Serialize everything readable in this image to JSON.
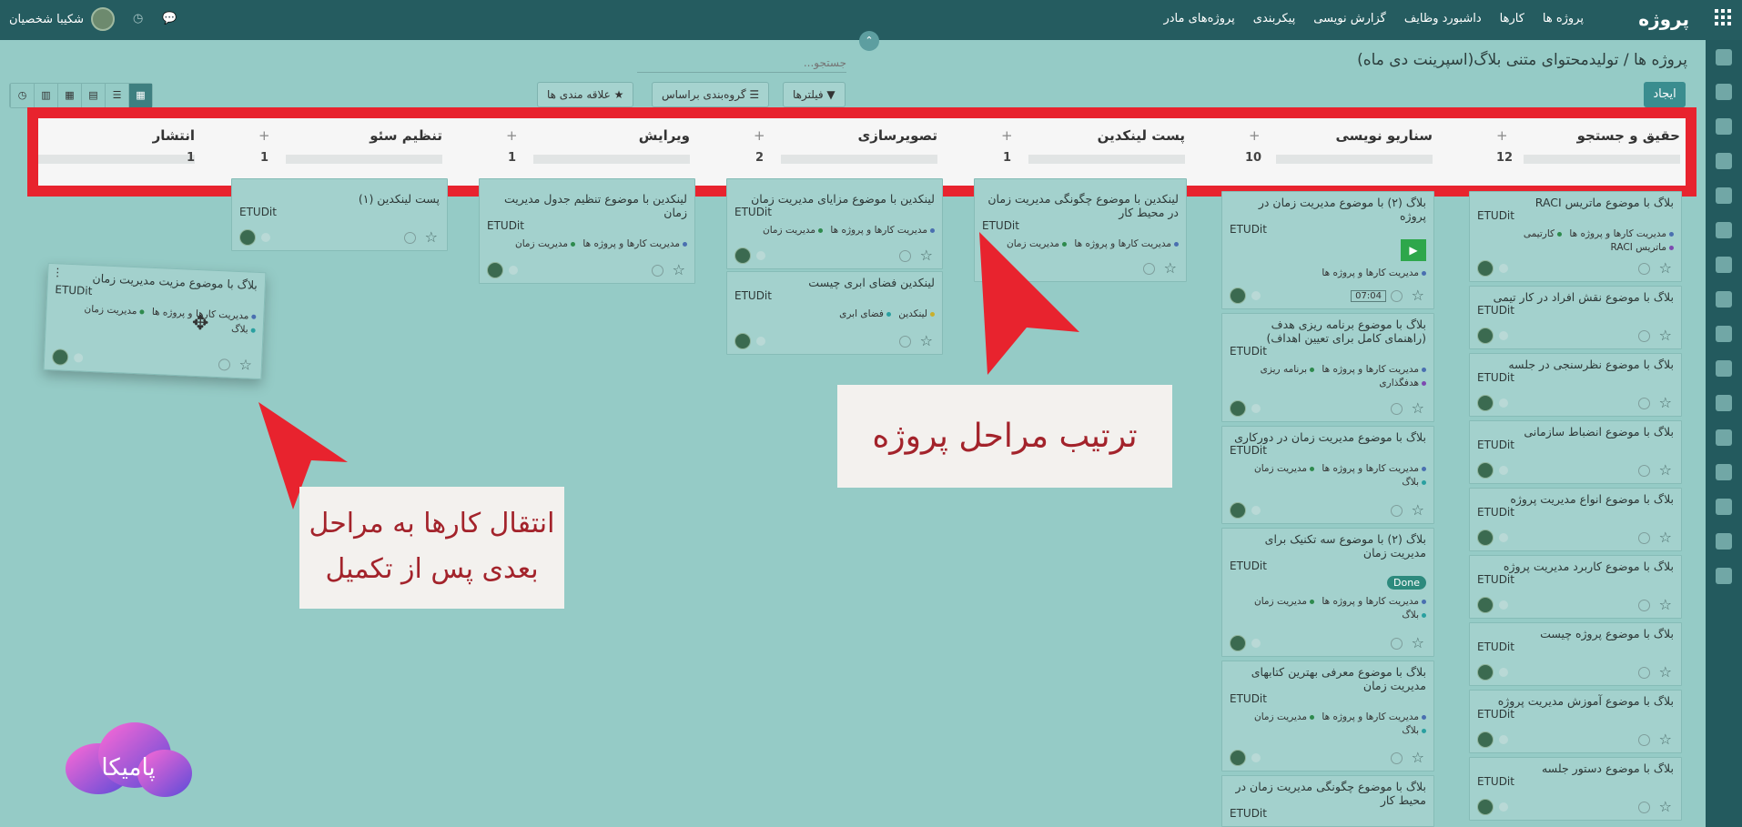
{
  "app": {
    "brand": "پروژه",
    "nav": [
      "پروژه ها",
      "کارها",
      "داشبورد وظایف",
      "گزارش نویسی",
      "پیکربندی",
      "پروژه‌های مادر"
    ],
    "user": "شکیبا شخصیان"
  },
  "breadcrumb": {
    "root": "پروژه ها",
    "sep": "/",
    "current": "تولیدمحتوای متنی بلاگ(اسپرینت دی ماه)"
  },
  "toolbar": {
    "create": "ایجاد",
    "search_placeholder": "جستجو...",
    "filters": "▼ فیلترها",
    "groupby": "☰ گروه‌بندی براساس",
    "favorites": "★ علاقه مندی ها"
  },
  "stages": [
    {
      "title": "حقیق و جستجو",
      "count": "12"
    },
    {
      "title": "سناریو نویسی",
      "count": "10"
    },
    {
      "title": "پست لینکدین",
      "count": "1"
    },
    {
      "title": "تصویرسازی",
      "count": "2"
    },
    {
      "title": "ویرایش",
      "count": "1"
    },
    {
      "title": "تنظیم سئو",
      "count": "1"
    },
    {
      "title": "انتشار",
      "count": "1"
    }
  ],
  "company": "ETUDit",
  "col1": [
    {
      "title": "بلاگ با موضوع ماتریس RACI",
      "tags": [
        "مدیریت کارها و پروژه ها",
        "کارتیمی",
        "ماتریس RACI"
      ]
    },
    {
      "title": "بلاگ با موضوع نقش افراد در کار تیمی"
    },
    {
      "title": "بلاگ با موضوع نظرسنجی در جلسه"
    },
    {
      "title": "بلاگ با موضوع انضباط سازمانی"
    },
    {
      "title": "بلاگ با موضوع انواع مدیریت پروژه"
    },
    {
      "title": "بلاگ با موضوع کاربرد مدیریت پروژه"
    },
    {
      "title": "بلاگ با موضوع پروژه چیست"
    },
    {
      "title": "بلاگ با موضوع آموزش مدیریت پروژه"
    },
    {
      "title": "بلاگ با موضوع دستور جلسه"
    }
  ],
  "col2": [
    {
      "title": "بلاگ (۲) با موضوع مدیریت زمان در پروژه",
      "tags": [
        "مدیریت کارها و پروژه ها"
      ],
      "timer": "07:04"
    },
    {
      "title": "بلاگ با موضوع برنامه ریزی هدف (راهنمای کامل برای تعیین اهداف)",
      "tags": [
        "مدیریت کارها و پروژه ها",
        "برنامه ریزی",
        "هدفگذاری"
      ]
    },
    {
      "title": "بلاگ با موضوع مدیریت زمان در دورکاری",
      "tags": [
        "مدیریت کارها و پروژه ها",
        "مدیریت زمان",
        "بلاگ"
      ]
    },
    {
      "title": "بلاگ (۲) با موضوع سه تکنیک برای مدیریت زمان",
      "badge": "Done",
      "tags": [
        "مدیریت کارها و پروژه ها",
        "مدیریت زمان",
        "بلاگ"
      ]
    },
    {
      "title": "بلاگ با موضوع معرفی بهترین کتابهای مدیریت زمان",
      "tags": [
        "مدیریت کارها و پروژه ها",
        "مدیریت زمان",
        "بلاگ"
      ]
    },
    {
      "title": "بلاگ با موضوع چگونگی مدیریت زمان در محیط کار"
    }
  ],
  "col3": [
    {
      "title": "لینکدین با موضوع چگونگی مدیریت زمان در محیط کار",
      "tags": [
        "مدیریت کارها و پروژه ها",
        "مدیریت زمان"
      ]
    }
  ],
  "col4": [
    {
      "title": "لینکدین با موضوع مزایای مدیریت زمان",
      "tags": [
        "مدیریت کارها و پروژه ها",
        "مدیریت زمان"
      ]
    },
    {
      "title": "لینکدین فضای ابری چیست",
      "tags": [
        "لینکدین",
        "فضای ابری"
      ]
    }
  ],
  "col5": [
    {
      "title": "لینکدین با موضوع تنظیم جدول مدیریت زمان",
      "tags": [
        "مدیریت کارها و پروژه ها",
        "مدیریت زمان"
      ]
    }
  ],
  "col6": [
    {
      "title": "پست لینکدین (۱)"
    }
  ],
  "dragged": {
    "title": "بلاگ با موضوع مزیت مدیریت زمان",
    "tags": [
      "مدیریت کارها و پروژه ها",
      "مدیریت زمان",
      "بلاگ"
    ]
  },
  "notes": {
    "order": "ترتیب مراحل پروژه",
    "move": "انتقال کارها به مراحل بعدی پس از تکمیل"
  },
  "logo_text": "پامیکا",
  "colors": {
    "topbar": "#255c60",
    "background": "#95cbc6",
    "highlight": "#e8232e"
  }
}
